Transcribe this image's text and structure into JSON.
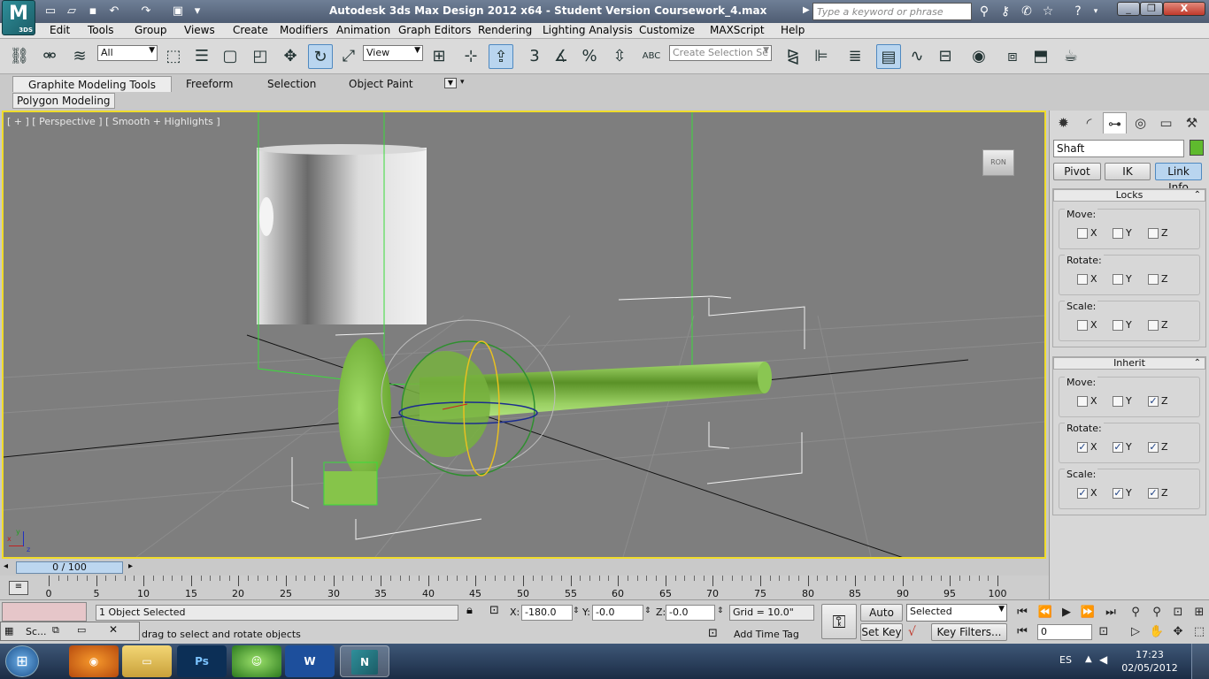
{
  "window": {
    "title": "Autodesk 3ds Max Design 2012 x64   - Student Version    Coursework_4.max",
    "app_logo": "M",
    "app_logo_sub": "3DS",
    "search_placeholder": "Type a keyword or phrase",
    "buttons": [
      "_",
      "❐",
      "X"
    ]
  },
  "menu": [
    "Edit",
    "Tools",
    "Group",
    "Views",
    "Create",
    "Modifiers",
    "Animation",
    "Graph Editors",
    "Rendering",
    "Lighting Analysis",
    "Customize",
    "MAXScript",
    "Help"
  ],
  "toolbar": {
    "selection_filter": "All",
    "reference_coord": "View",
    "snap_label": "3",
    "named_selection_placeholder": "Create Selection Se",
    "abc_label": "ABC"
  },
  "ribbon": {
    "tabs": [
      "Graphite Modeling Tools",
      "Freeform",
      "Selection",
      "Object Paint"
    ],
    "panel": "Polygon Modeling"
  },
  "viewport": {
    "label": "[ + ] [ Perspective ] [ Smooth + Highlights ]",
    "viewcube_label": "RON",
    "axes": {
      "x": "x",
      "y": "y",
      "z": "z"
    }
  },
  "command_panel": {
    "object_name": "Shaft",
    "object_color": "#5fba2e",
    "buttons": [
      "Pivot",
      "IK",
      "Link Info"
    ],
    "active_button": "Link Info",
    "locks": {
      "title": "Locks",
      "groups": [
        {
          "label": "Move:",
          "x": false,
          "y": false,
          "z": false
        },
        {
          "label": "Rotate:",
          "x": false,
          "y": false,
          "z": false
        },
        {
          "label": "Scale:",
          "x": false,
          "y": false,
          "z": false
        }
      ]
    },
    "inherit": {
      "title": "Inherit",
      "groups": [
        {
          "label": "Move:",
          "x": false,
          "y": false,
          "z": true
        },
        {
          "label": "Rotate:",
          "x": true,
          "y": true,
          "z": true
        },
        {
          "label": "Scale:",
          "x": true,
          "y": true,
          "z": true
        }
      ]
    },
    "axis_labels": [
      "X",
      "Y",
      "Z"
    ]
  },
  "timeline": {
    "slider_label": "0 / 100",
    "ticks": [
      0,
      5,
      10,
      15,
      20,
      25,
      30,
      35,
      40,
      45,
      50,
      55,
      60,
      65,
      70,
      75,
      80,
      85,
      90,
      95,
      100
    ]
  },
  "status": {
    "selection": "1 Object Selected",
    "prompt": "drag to select and rotate objects",
    "mini_listener": "Sc...",
    "x_label": "X:",
    "x_value": "-180.0",
    "y_label": "Y:",
    "y_value": "-0.0",
    "z_label": "Z:",
    "z_value": "-0.0",
    "grid": "Grid = 10.0\"",
    "add_time_tag": "Add Time Tag",
    "auto_key": "Auto Key",
    "set_key": "Set Key",
    "key_mode": "Selected",
    "key_filters": "Key Filters...",
    "frame": "0"
  },
  "taskbar": {
    "apps": [
      "Start",
      "Firefox",
      "Explorer",
      "Ps",
      "Messenger",
      "W",
      "3ds Max"
    ],
    "language": "ES",
    "time": "17:23",
    "date": "02/05/2012"
  }
}
